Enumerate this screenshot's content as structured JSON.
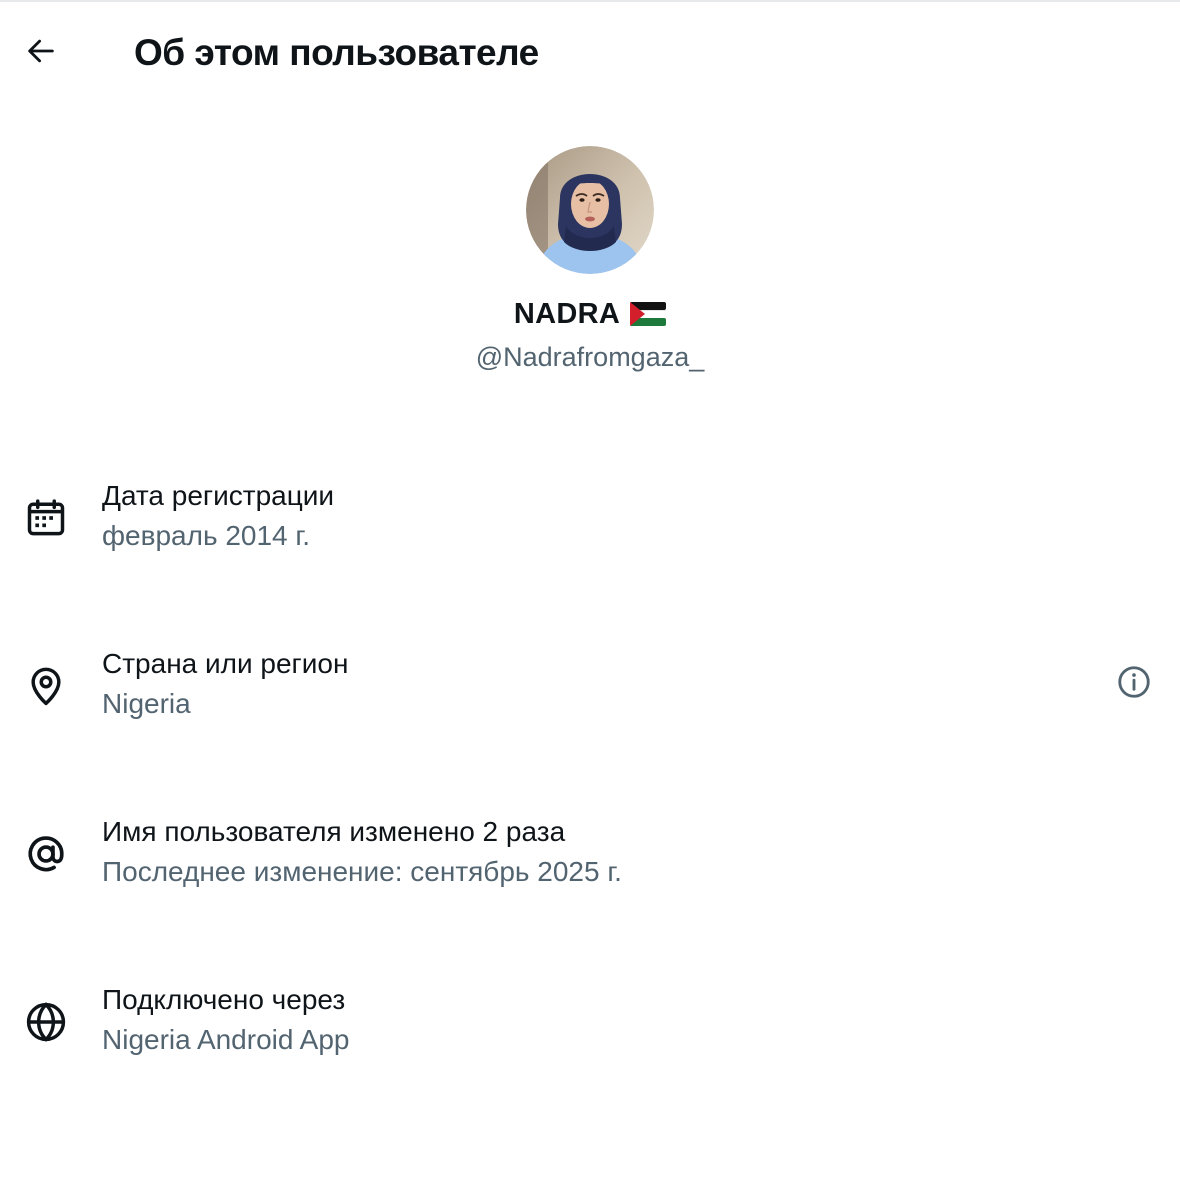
{
  "header": {
    "title": "Об этом пользователе",
    "back_icon": "arrow-left-icon"
  },
  "profile": {
    "display_name": "NADRA",
    "flag_icon": "palestine-flag-icon",
    "handle": "@Nadrafromgaza_",
    "avatar": "user-avatar-photo"
  },
  "info": [
    {
      "icon": "calendar-icon",
      "label": "Дата регистрации",
      "value": "февраль 2014 г."
    },
    {
      "icon": "location-pin-icon",
      "label": "Страна или регион",
      "value": "Nigeria",
      "help_icon": "info-circle-icon"
    },
    {
      "icon": "at-sign-icon",
      "label": "Имя пользователя изменено 2 раза",
      "value": "Последнее изменение: сентябрь 2025 г."
    },
    {
      "icon": "globe-icon",
      "label": "Подключено через",
      "value": "Nigeria Android App"
    }
  ],
  "colors": {
    "text_primary": "#0f1419",
    "text_secondary": "#536471",
    "background": "#ffffff"
  }
}
